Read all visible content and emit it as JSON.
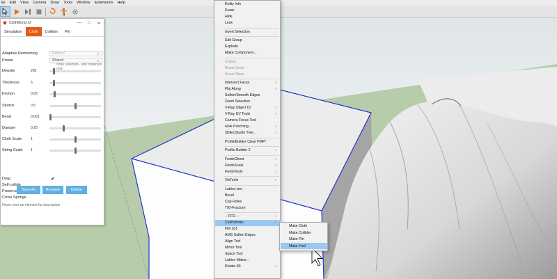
{
  "menubar": [
    "ile",
    "Edit",
    "View",
    "Camera",
    "Draw",
    "Tools",
    "Window",
    "Extensions",
    "Help"
  ],
  "panel": {
    "title": "ClothWorks UI",
    "tabs": [
      "Simulation",
      "Cloth",
      "Collider",
      "Pin"
    ],
    "active_tab": "Cloth",
    "no_selection": "none selected - edit materials only",
    "adaptive_remeshing": {
      "label": "Adaptive Remeshing",
      "value": "Refine 6"
    },
    "preset": {
      "label": "Preset",
      "value": "Shared"
    },
    "params": [
      {
        "label": "Density",
        "value": "200",
        "level": 0.07
      },
      {
        "label": "Thickness",
        "value": "5",
        "level": 0.07
      },
      {
        "label": "Friction",
        "value": "0.05",
        "level": 0.09
      },
      {
        "label": "Stretch",
        "value": "0.5",
        "level": 0.5
      },
      {
        "label": "Bend",
        "value": "0.001",
        "level": 0.0
      },
      {
        "label": "Damper",
        "value": "0.25",
        "level": 0.27
      },
      {
        "label": "Cloth Scale",
        "value": "1",
        "level": 0.5
      },
      {
        "label": "String Scale",
        "value": "1",
        "level": 0.5
      }
    ],
    "checks": [
      {
        "label": "Drag",
        "checked": true
      },
      {
        "label": "Self-collide",
        "checked": false
      },
      {
        "label": "Preserve Shape",
        "checked": true
      },
      {
        "label": "Cross Springs",
        "checked": false
      }
    ],
    "buttons": {
      "save_as": "Save As",
      "rename": "Rename",
      "delete": "Delete"
    },
    "hint": "Hover over an element for description"
  },
  "context_menu": {
    "items": [
      {
        "label": "Entity Info"
      },
      {
        "label": "Erase"
      },
      {
        "label": "Hide"
      },
      {
        "label": "Lock"
      },
      {
        "sep": true
      },
      {
        "label": "Invert Selection"
      },
      {
        "sep": true
      },
      {
        "label": "Edit Group"
      },
      {
        "label": "Explode"
      },
      {
        "label": "Make Component..."
      },
      {
        "sep": true
      },
      {
        "label": "Unglue",
        "disabled": true
      },
      {
        "label": "Reset Scale",
        "disabled": true
      },
      {
        "label": "Reset Skew",
        "disabled": true
      },
      {
        "sep": true
      },
      {
        "label": "Intersect Faces",
        "arrow": true
      },
      {
        "label": "Flip Along",
        "arrow": true
      },
      {
        "label": "Soften/Smooth Edges"
      },
      {
        "label": "Zoom Selection"
      },
      {
        "label": "V-Ray Object ID",
        "arrow": true
      },
      {
        "label": "V-Ray UV Tools",
        "arrow": true
      },
      {
        "label": "Camera Focus Tool"
      },
      {
        "label": "Hole Punching...",
        "arrow": true
      },
      {
        "label": "3DArcStudio Tree...",
        "arrow": true
      },
      {
        "sep": true
      },
      {
        "label": "ProfileBuilder Clear PMP!"
      },
      {
        "sep": true
      },
      {
        "label": "Profile Builder 2",
        "arrow": true
      },
      {
        "sep": true
      },
      {
        "label": "FredoGhost",
        "arrow": true
      },
      {
        "label": "FredoScale",
        "arrow": true
      },
      {
        "label": "FredoTools",
        "arrow": true
      },
      {
        "sep": true
      },
      {
        "label": "VisTools",
        "arrow": true
      },
      {
        "sep": true
      },
      {
        "label": "Lattice-izer"
      },
      {
        "label": "Bevel"
      },
      {
        "label": "Cap Holes"
      },
      {
        "label": "TIG-Fracture"
      },
      {
        "sep": true
      },
      {
        "label": "-- FFD --",
        "arrow": true
      },
      {
        "label": "ClothWorks",
        "arrow": true,
        "highlight": true
      },
      {
        "label": "Fillt 101"
      },
      {
        "label": "AMS Soften Edges"
      },
      {
        "label": "Align Tool"
      },
      {
        "label": "Mirror Tool"
      },
      {
        "label": "Space Tool"
      },
      {
        "label": "Lattice Maker..."
      },
      {
        "label": "Rotate 90",
        "arrow": true
      }
    ]
  },
  "submenu": {
    "items": [
      "Make Cloth",
      "Make Collider",
      "Make Pin",
      "Make Yuel"
    ],
    "highlighted": "Make Yuel"
  }
}
